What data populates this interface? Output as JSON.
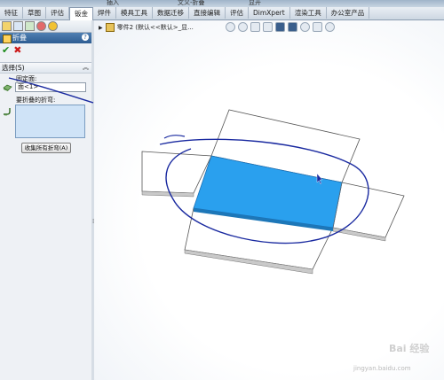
{
  "titlebar": {
    "left_text": "插入",
    "mid_text": "文义-折叠",
    "right_text": "显开"
  },
  "tabs": [
    {
      "label": "特征"
    },
    {
      "label": "草图"
    },
    {
      "label": "评估"
    },
    {
      "label": "钣金"
    },
    {
      "label": "焊件"
    },
    {
      "label": "模具工具"
    },
    {
      "label": "数据迁移"
    },
    {
      "label": "直接编辑"
    },
    {
      "label": "评估"
    },
    {
      "label": "DimXpert"
    },
    {
      "label": "渲染工具"
    },
    {
      "label": "办公室产品"
    }
  ],
  "active_tab_index": 3,
  "property_manager": {
    "title": "折叠",
    "help_glyph": "?",
    "ok_glyph": "✔",
    "cancel_glyph": "✖",
    "selection": {
      "header": "选择(S)",
      "chevron": "︽",
      "fixed_face_label": "固定面:",
      "fixed_face_value": "面<1>",
      "bends_label": "要折叠的折弯:",
      "collect_button": "收集所有折弯(A)"
    }
  },
  "tree": {
    "expand_glyph": "▶",
    "text": "零件2 (默认<<默认>_显..."
  },
  "watermark": {
    "logo_text": "Bai 经验",
    "url_text": "jingyan.baidu.com"
  },
  "colors": {
    "selected_face": "#2aa0ee",
    "annotation_stroke": "#1a2aa0",
    "accent_header": "#2e5d92"
  },
  "icons": [
    "part-icon",
    "zoom-fit-icon",
    "zoom-area-icon",
    "previous-view-icon",
    "section-view-icon",
    "view-orientation-icon",
    "display-style-icon",
    "hide-show-icon",
    "appearance-icon",
    "scene-icon"
  ]
}
